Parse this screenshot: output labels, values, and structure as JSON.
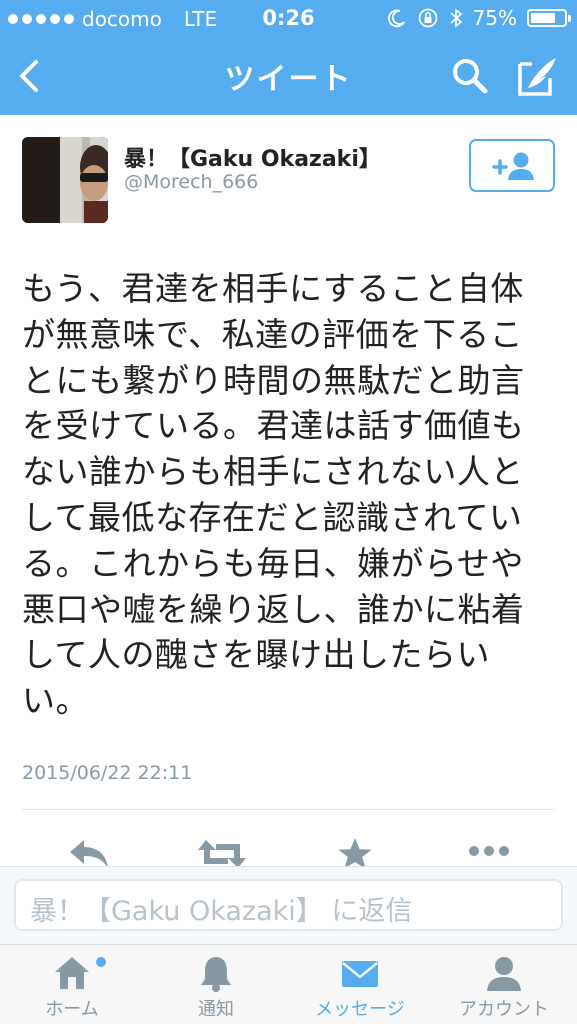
{
  "status_bar": {
    "carrier": "docomo",
    "network": "LTE",
    "time": "0:26",
    "battery_percent": "75%",
    "battery_level": 0.75
  },
  "nav": {
    "title": "ツイート",
    "icons": [
      "back-chevron-icon",
      "search-icon",
      "compose-icon"
    ]
  },
  "tweet": {
    "display_name": "暴！【Gaku Okazaki】",
    "handle": "@Morech_666",
    "text": "もう、君達を相手にすること自体が無意味で、私達の評価を下ることにも繋がり時間の無駄だと助言を受けている。君達は話す価値もない誰からも相手にされない人として最低な存在だと認識されている。これからも毎日、嫌がらせや悪口や嘘を繰り返し、誰かに粘着して人の醜さを曝け出したらいい。",
    "timestamp": "2015/06/22 22:11"
  },
  "reply": {
    "placeholder": "暴！【Gaku Okazaki】 に返信"
  },
  "tabs": [
    {
      "label": "ホーム",
      "icon": "home-icon",
      "active": false
    },
    {
      "label": "通知",
      "icon": "bell-icon",
      "active": false
    },
    {
      "label": "メッセージ",
      "icon": "envelope-icon",
      "active": true
    },
    {
      "label": "アカウント",
      "icon": "person-icon",
      "active": false
    }
  ],
  "colors": {
    "accent": "#55acee",
    "text": "#222222",
    "secondary": "#8899a6",
    "action_icon": "#8899a6"
  }
}
